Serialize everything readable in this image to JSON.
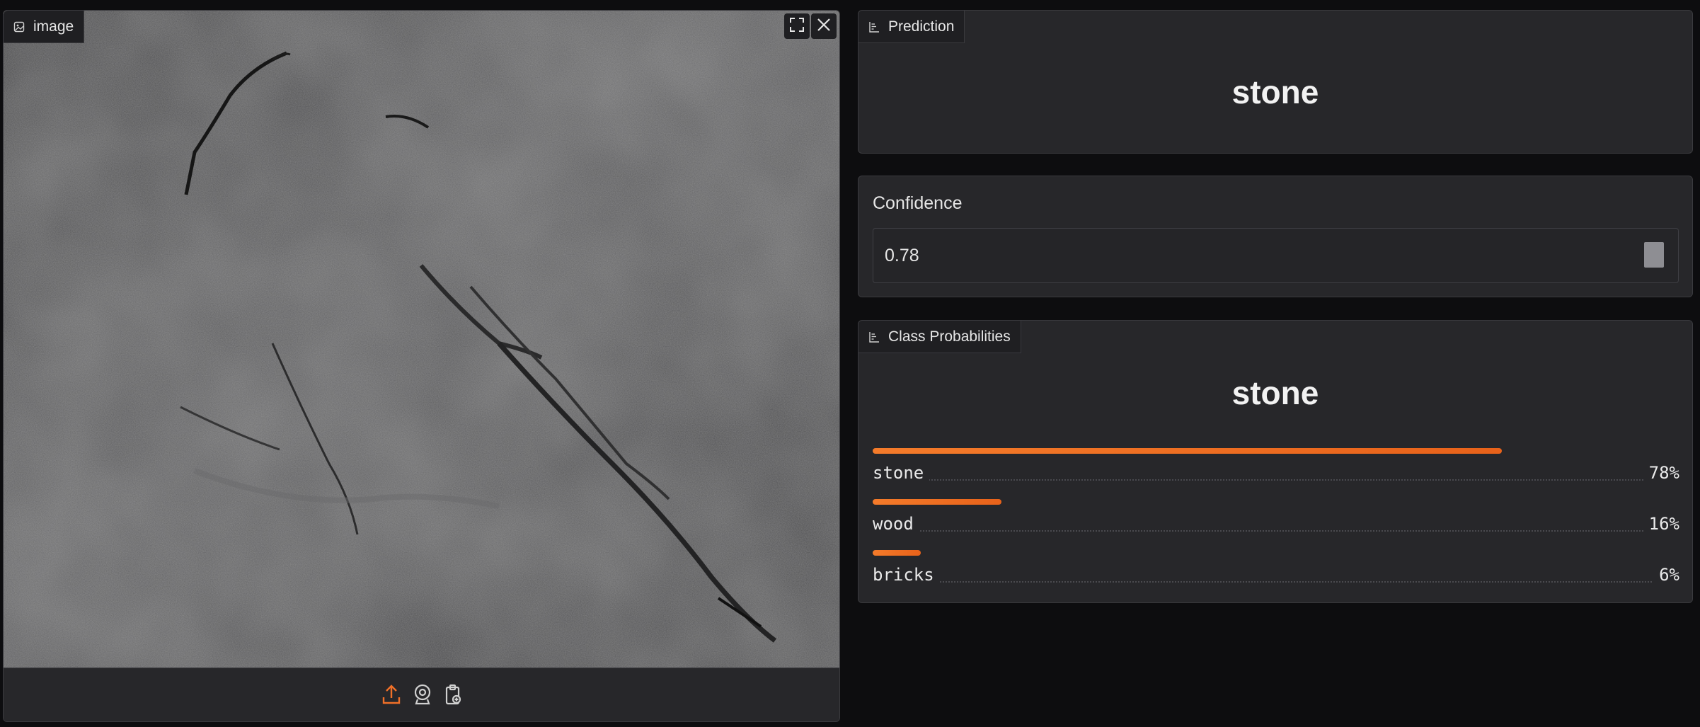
{
  "image_input": {
    "label": "image",
    "icons": [
      "image-icon",
      "fullscreen-icon",
      "close-icon",
      "upload-icon",
      "webcam-icon",
      "clipboard-icon"
    ]
  },
  "prediction": {
    "label": "Prediction",
    "value": "stone"
  },
  "confidence": {
    "label": "Confidence",
    "value": "0.78"
  },
  "class_probabilities": {
    "label": "Class Probabilities",
    "top_label": "stone",
    "items": [
      {
        "name": "stone",
        "percent": "78%",
        "fraction": 0.78
      },
      {
        "name": "wood",
        "percent": "16%",
        "fraction": 0.16
      },
      {
        "name": "bricks",
        "percent": "6%",
        "fraction": 0.06
      }
    ]
  },
  "colors": {
    "background": "#0d0d0f",
    "panel": "#27272a",
    "accent": "#f07028",
    "border": "#3a3a3e"
  }
}
